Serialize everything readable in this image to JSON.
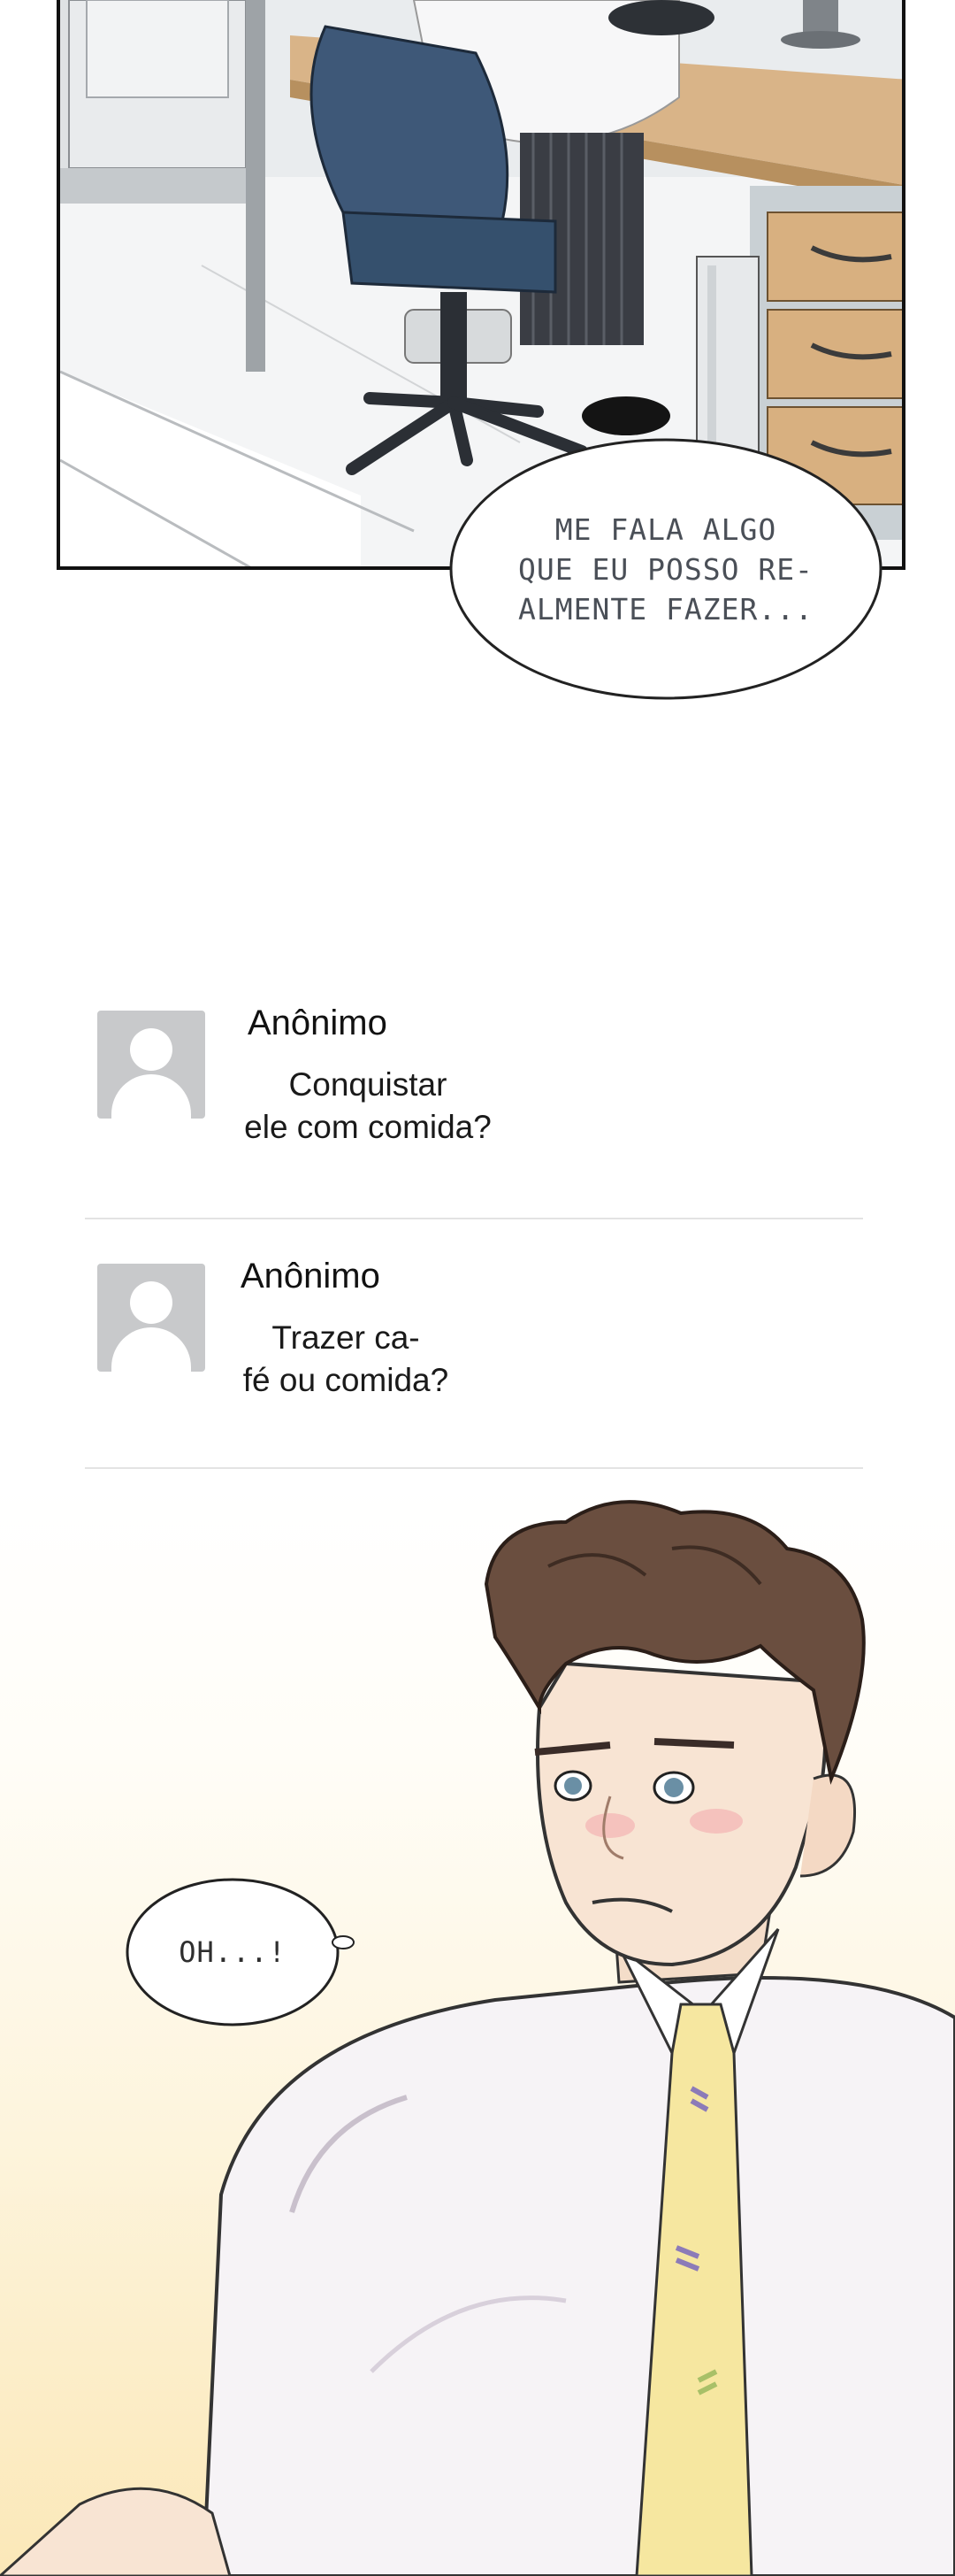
{
  "panel_1": {
    "speech_bubble": "ME FALA ALGO\nQUE EU POSSO RE-\nALMENTE FAZER..."
  },
  "comments": [
    {
      "author": "Anônimo",
      "text": "Conquistar\nele com comida?"
    },
    {
      "author": "Anônimo",
      "text": "Trazer ca-\nfé ou comida?"
    }
  ],
  "panel_2": {
    "speech_bubble": "OH...!"
  },
  "colors": {
    "avatar_gray": "#c8c9cb",
    "divider": "#e3e3e3",
    "warm_background": "#fbe8b8",
    "tie_yellow": "#f6e7a0",
    "chair_blue": "#3e5878"
  },
  "icons": {
    "avatar": "default-user-silhouette-icon"
  }
}
